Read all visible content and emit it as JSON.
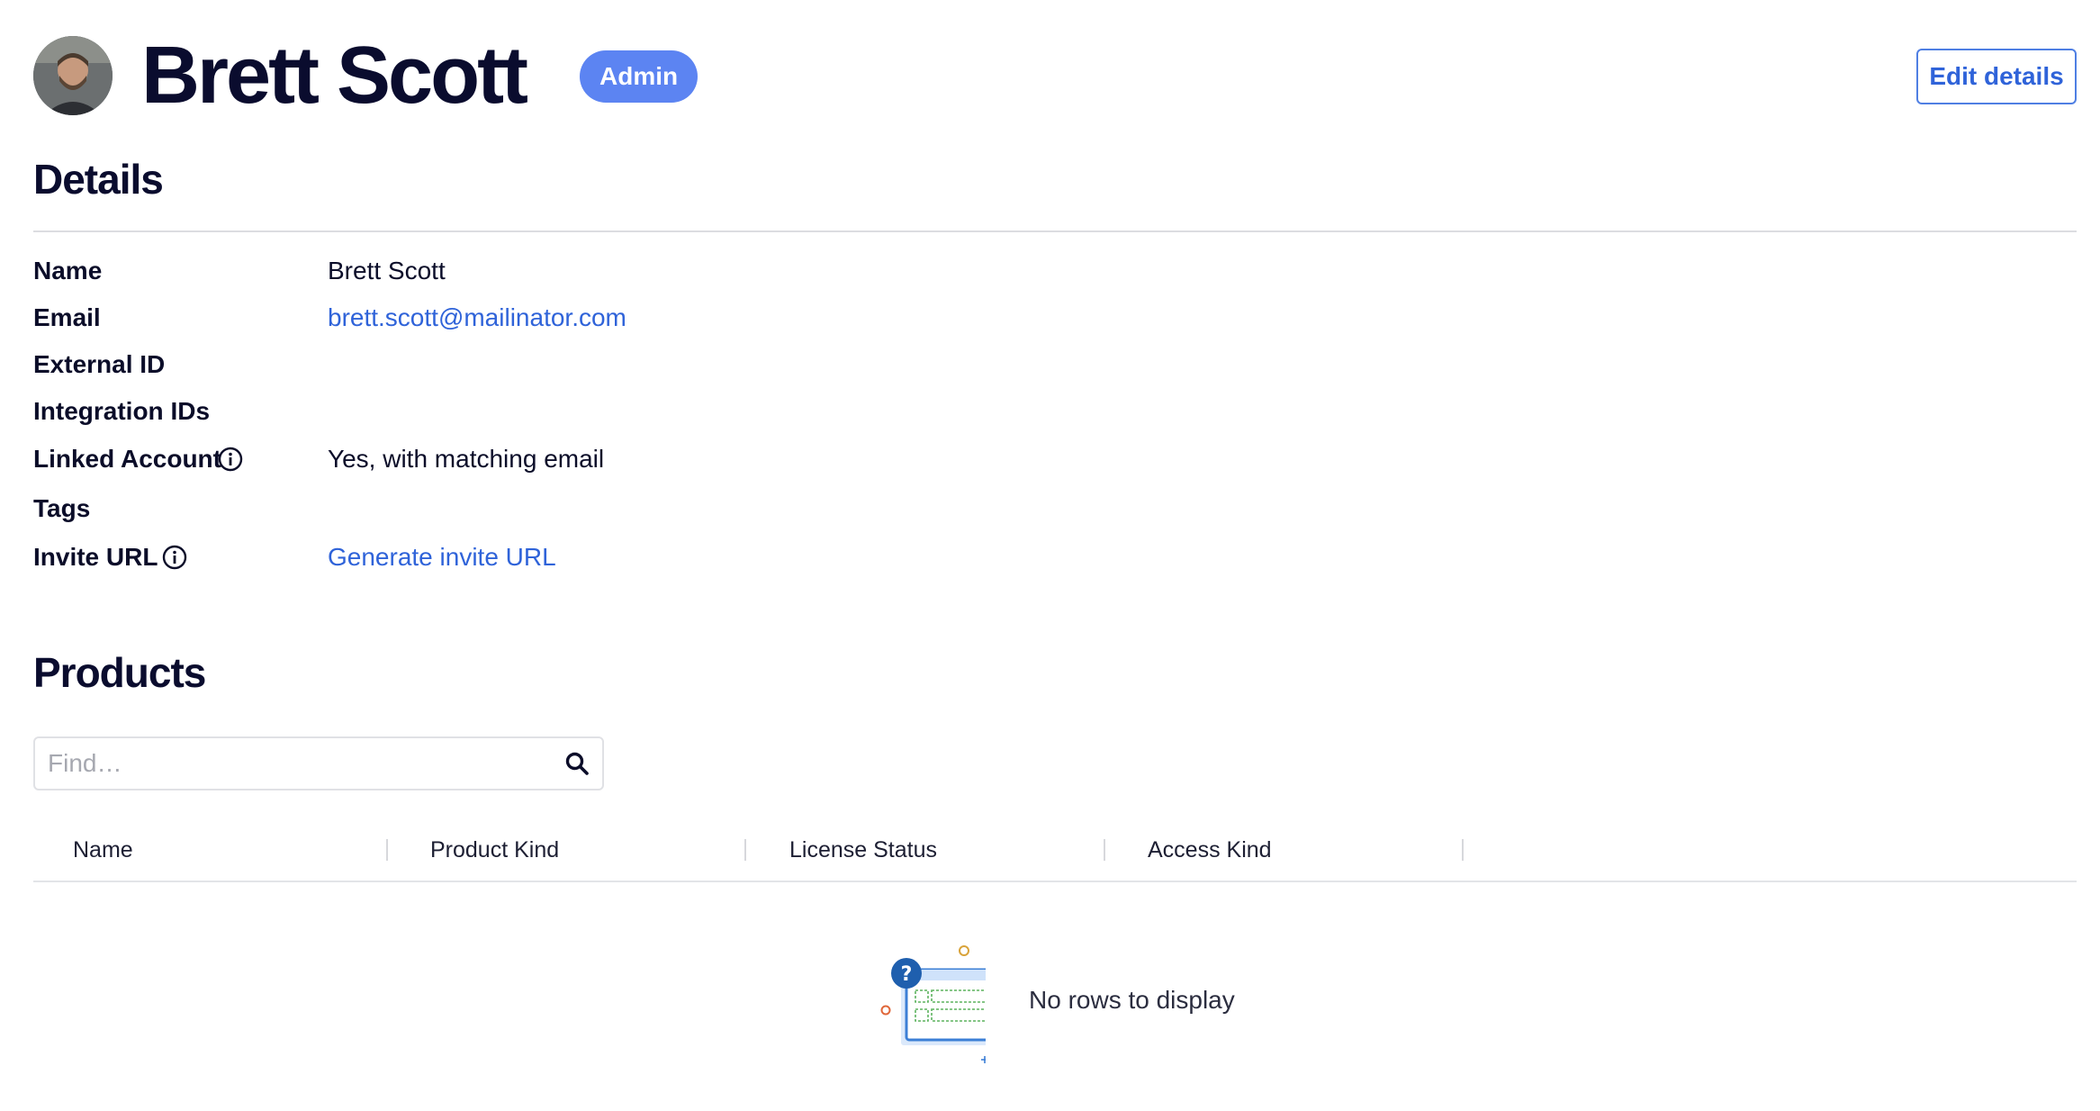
{
  "user": {
    "name": "Brett Scott",
    "role_badge": "Admin",
    "edit_button": "Edit details"
  },
  "details": {
    "title": "Details",
    "fields": [
      {
        "label": "Name",
        "value": "Brett Scott"
      },
      {
        "label": "Email",
        "value": "brett.scott@mailinator.com"
      },
      {
        "label": "External ID",
        "value": ""
      },
      {
        "label": "Integration IDs",
        "value": ""
      },
      {
        "label": "Linked Account",
        "value": "Yes, with matching email"
      },
      {
        "label": "Tags",
        "value": ""
      },
      {
        "label": "Invite URL",
        "value": "Generate invite URL"
      }
    ]
  },
  "products": {
    "title": "Products",
    "search_placeholder": "Find…",
    "columns": [
      "Name",
      "Product Kind",
      "License Status",
      "Access Kind"
    ],
    "empty_message": "No rows to display"
  },
  "colors": {
    "accent": "#2f63d9",
    "badge": "#5c84f2",
    "heading": "#0a0c2e"
  },
  "icons": [
    "avatar",
    "info-icon",
    "search-icon",
    "empty-table-illustration"
  ]
}
